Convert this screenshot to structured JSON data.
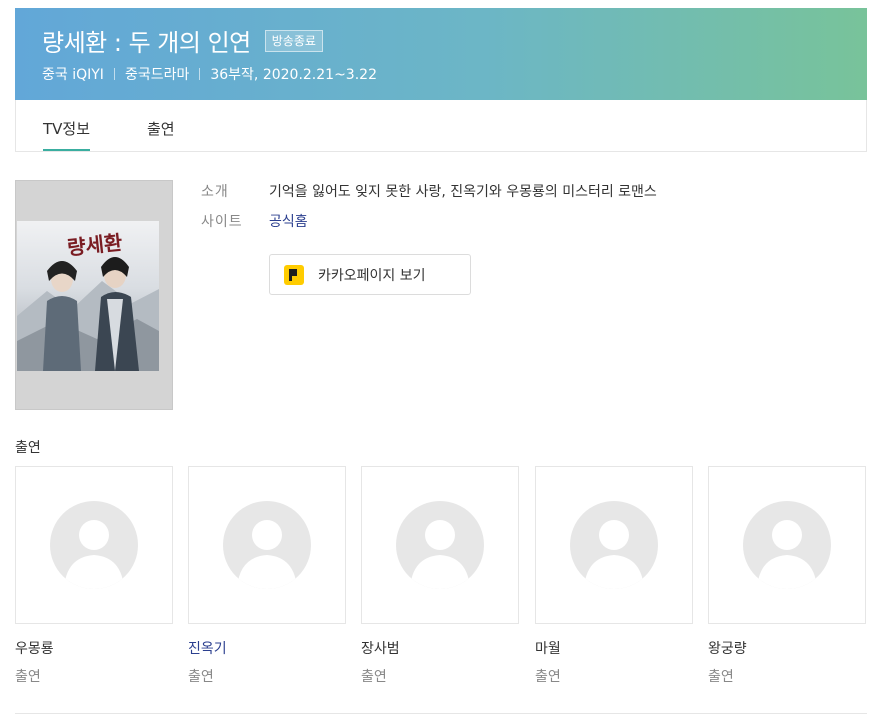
{
  "header": {
    "title": "량세환 : 두 개의 인연",
    "status_badge": "방송종료",
    "meta": [
      "중국 iQIYI",
      "중국드라마",
      "36부작, 2020.2.21~3.22"
    ]
  },
  "tabs": [
    {
      "label": "TV정보",
      "active": true
    },
    {
      "label": "출연",
      "active": false
    }
  ],
  "poster": {
    "logo_text": "량세환"
  },
  "info": {
    "intro_label": "소개",
    "intro_value": "기억을 잃어도 잊지 못한 사랑, 진옥기와 우몽룡의 미스터리 로맨스",
    "site_label": "사이트",
    "site_value": "공식홈"
  },
  "kakao_button": {
    "label": "카카오페이지 보기",
    "icon": "kakaopage-icon"
  },
  "cast_section": {
    "heading": "출연",
    "members": [
      {
        "name": "우몽룡",
        "role": "출연"
      },
      {
        "name": "진옥기",
        "role": "출연"
      },
      {
        "name": "장사범",
        "role": "출연"
      },
      {
        "name": "마월",
        "role": "출연"
      },
      {
        "name": "왕궁량",
        "role": "출연"
      }
    ]
  },
  "colors": {
    "header_gradient_start": "#62a7d8",
    "header_gradient_end": "#78c39a",
    "active_tab_underline": "#3aaea0",
    "link": "#2b3f8f",
    "kakao_yellow": "#ffcc00"
  }
}
